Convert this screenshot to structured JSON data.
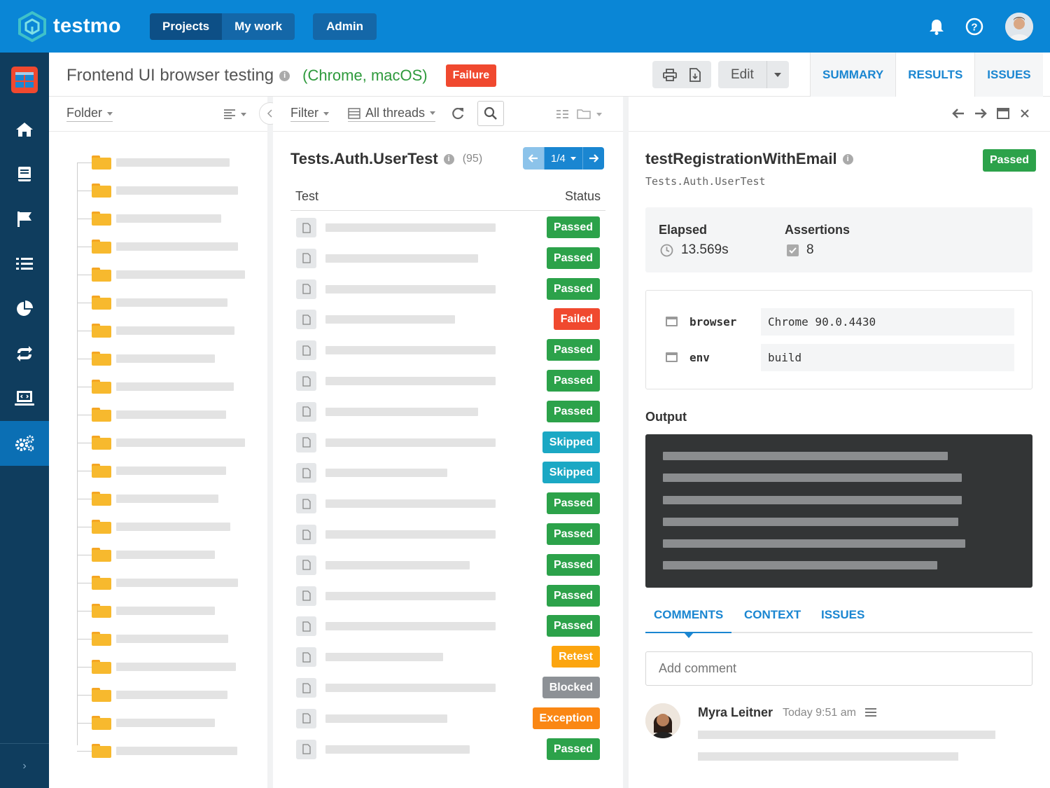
{
  "app": {
    "name": "testmo",
    "nav": [
      "Projects",
      "My work"
    ],
    "admin": "Admin",
    "icons": [
      "bell-icon",
      "help-icon",
      "user-avatar"
    ]
  },
  "sidebar": {
    "items": [
      "dashboard-icon",
      "home-icon",
      "book-icon",
      "flag-icon",
      "list-icon",
      "pie-chart-icon",
      "repeat-icon",
      "monitor-icon",
      "settings-icon"
    ],
    "active": "settings-icon",
    "expand_icon": "›"
  },
  "header": {
    "title": "Frontend UI browser testing",
    "subtitle": "(Chrome, macOS)",
    "badge": "Failure",
    "edit_label": "Edit",
    "tabs": [
      "SUMMARY",
      "RESULTS",
      "ISSUES"
    ],
    "active_tab": "RESULTS"
  },
  "folders_toolbar": {
    "label": "Folder"
  },
  "tests_toolbar": {
    "filter_label": "Filter",
    "threads_label": "All threads"
  },
  "tests": {
    "suite": "Tests.Auth.UserTest",
    "count": "(95)",
    "page": "1/4",
    "col_test": "Test",
    "col_status": "Status",
    "rows": [
      {
        "status": "Passed"
      },
      {
        "status": "Passed"
      },
      {
        "status": "Passed"
      },
      {
        "status": "Failed"
      },
      {
        "status": "Passed"
      },
      {
        "status": "Passed"
      },
      {
        "status": "Passed"
      },
      {
        "status": "Skipped"
      },
      {
        "status": "Skipped"
      },
      {
        "status": "Passed"
      },
      {
        "status": "Passed"
      },
      {
        "status": "Passed"
      },
      {
        "status": "Passed"
      },
      {
        "status": "Passed"
      },
      {
        "status": "Retest"
      },
      {
        "status": "Blocked"
      },
      {
        "status": "Exception"
      },
      {
        "status": "Passed"
      }
    ]
  },
  "status_colors": {
    "Passed": "#2ca24a",
    "Failed": "#f0492f",
    "Skipped": "#1ba8c4",
    "Retest": "#fca50f",
    "Blocked": "#8d9196",
    "Exception": "#fa8714"
  },
  "detail": {
    "title": "testRegistrationWithEmail",
    "class": "Tests.Auth.UserTest",
    "status": "Passed",
    "elapsed_label": "Elapsed",
    "elapsed_value": "13.569s",
    "assertions_label": "Assertions",
    "assertions_value": "8",
    "fields": [
      {
        "name": "browser",
        "value": "Chrome 90.0.4430"
      },
      {
        "name": "env",
        "value": "build"
      }
    ],
    "output_label": "Output",
    "tabs": [
      "COMMENTS",
      "CONTEXT",
      "ISSUES"
    ],
    "comment_placeholder": "Add comment",
    "comment": {
      "author": "Myra Leitner",
      "time": "Today 9:51 am"
    }
  }
}
